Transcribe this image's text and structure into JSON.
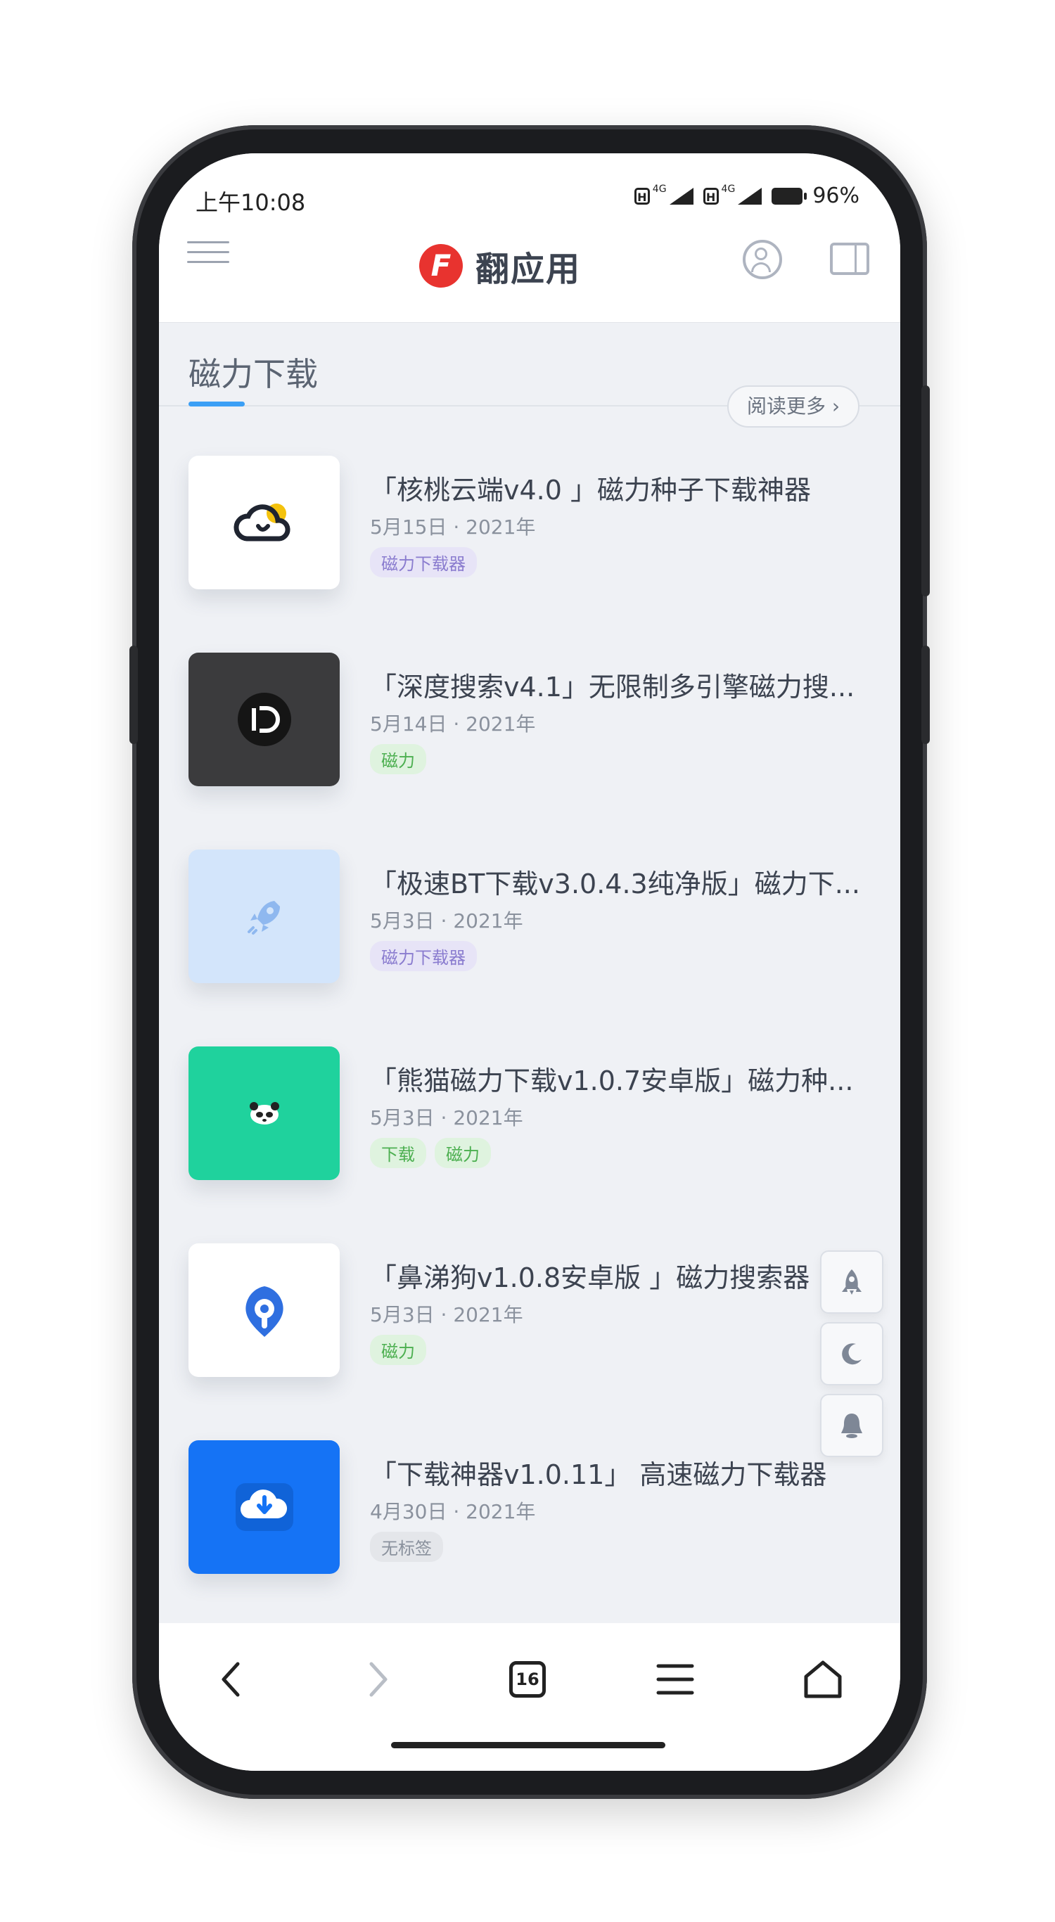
{
  "status": {
    "time": "上午10:08",
    "battery": "96%",
    "network_label": "4G"
  },
  "appbar": {
    "logo_letter": "F",
    "title": "翻应用"
  },
  "section": {
    "title": "磁力下载",
    "read_more": "阅读更多 ›"
  },
  "items": [
    {
      "title": "「核桃云端v4.0 」磁力种子下载神器",
      "date": "5月15日 · 2021年",
      "tags": [
        "磁力下载器"
      ],
      "thumb_bg": "#ffffff",
      "icon": "cloud-sun-icon"
    },
    {
      "title": "「深度搜索v4.1」无限制多引擎磁力搜...",
      "date": "5月14日 · 2021年",
      "tags": [
        "磁力"
      ],
      "thumb_bg": "#3b3b3d",
      "icon": "d-logo-icon"
    },
    {
      "title": "「极速BT下载v3.0.4.3纯净版」磁力下...",
      "date": "5月3日 · 2021年",
      "tags": [
        "磁力下载器"
      ],
      "thumb_bg": "#d3e5fb",
      "icon": "rocket-icon"
    },
    {
      "title": "「熊猫磁力下载v1.0.7安卓版」磁力种...",
      "date": "5月3日 · 2021年",
      "tags": [
        "下载",
        "磁力"
      ],
      "thumb_bg": "#1fd29d",
      "icon": "panda-icon"
    },
    {
      "title": "「鼻涕狗v1.0.8安卓版 」磁力搜索器",
      "date": "5月3日 · 2021年",
      "tags": [
        "磁力"
      ],
      "thumb_bg": "#ffffff",
      "icon": "dog-drop-icon"
    },
    {
      "title": "「下载神器v1.0.11」 高速磁力下载器",
      "date": "4月30日 · 2021年",
      "tags": [
        "无标签"
      ],
      "thumb_bg": "#1573f5",
      "icon": "cloud-download-icon"
    }
  ],
  "floating": [
    "rocket-icon",
    "moon-icon",
    "bell-icon"
  ],
  "bottom_nav": {
    "tab_count": "16"
  },
  "colors": {
    "accent": "#3b9ff5",
    "logo_red": "#e8332f",
    "screen_bg": "#eff1f5"
  }
}
